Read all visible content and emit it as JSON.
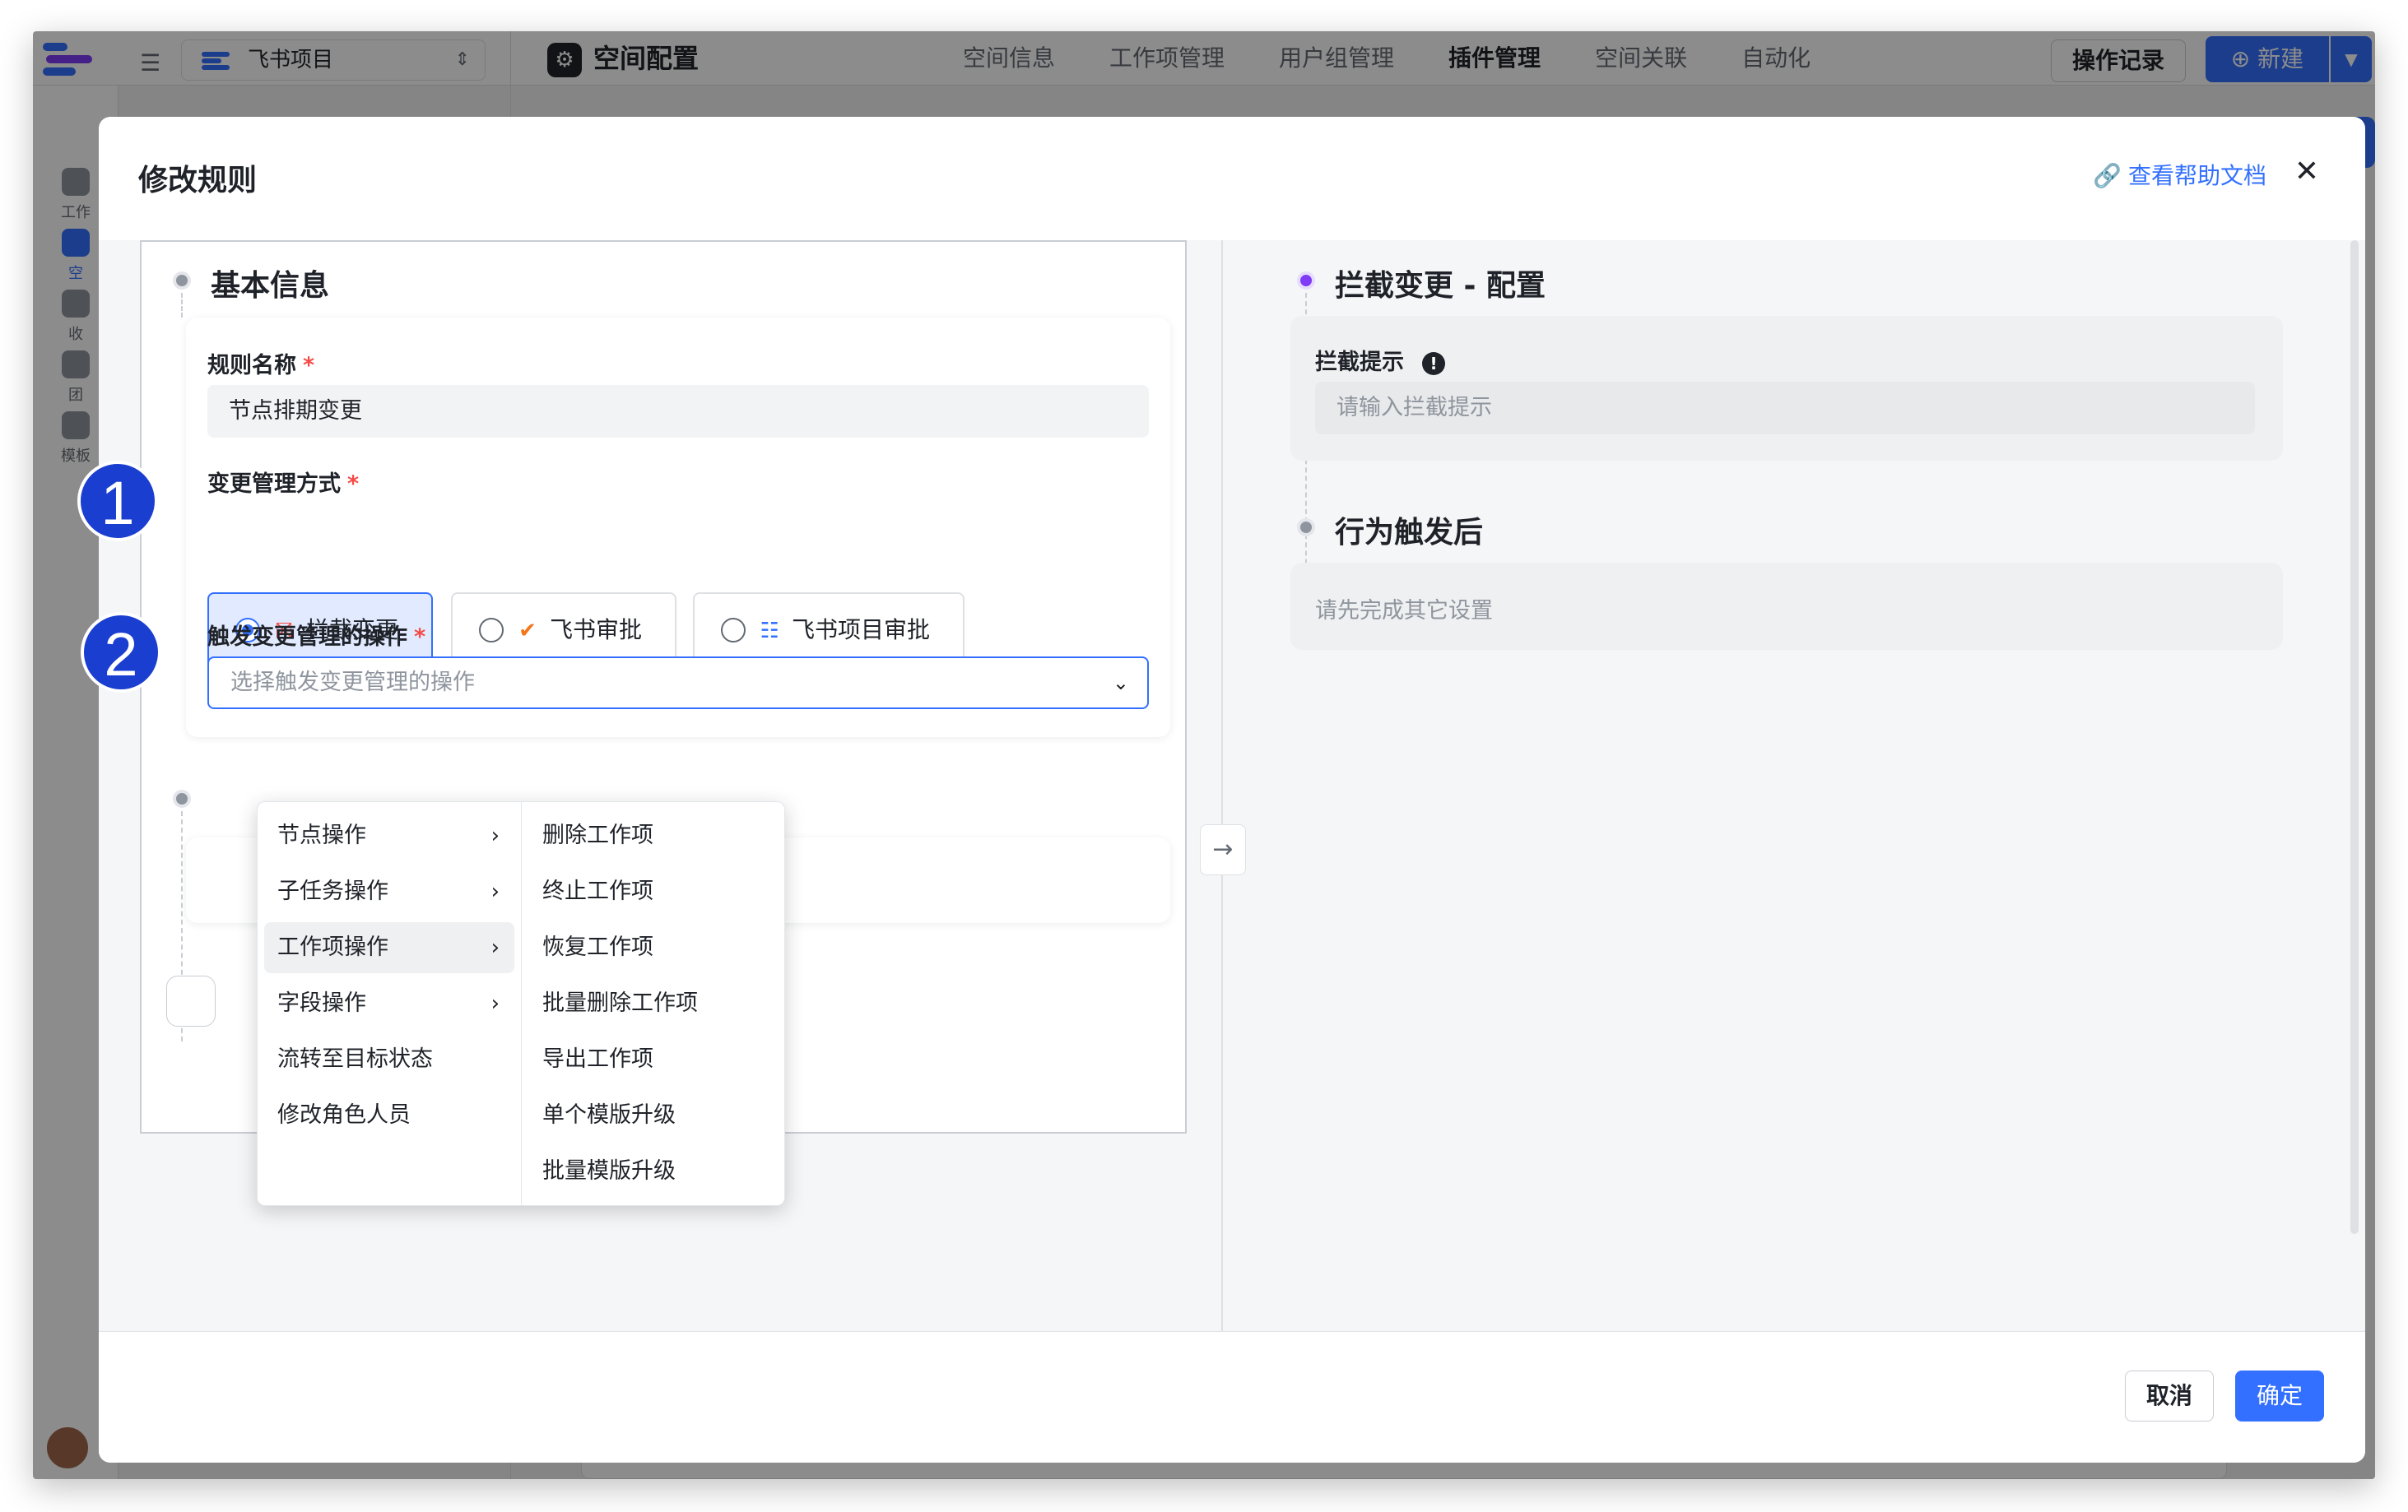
{
  "app": {
    "project_name": "飞书项目",
    "space_title": "空间配置",
    "tabs": [
      {
        "label": "空间信息",
        "active": false
      },
      {
        "label": "工作项管理",
        "active": false
      },
      {
        "label": "用户组管理",
        "active": false
      },
      {
        "label": "插件管理",
        "active": true
      },
      {
        "label": "空间关联",
        "active": false
      },
      {
        "label": "自动化",
        "active": false
      }
    ],
    "op_record_label": "操作记录",
    "new_label": "新建",
    "sidebar_items": [
      "工作",
      "空",
      "收",
      "团",
      "模板"
    ]
  },
  "modal": {
    "title": "修改规则",
    "help_link": "查看帮助文档",
    "close_symbol": "✕",
    "cancel_label": "取消",
    "ok_label": "确定"
  },
  "basic_info": {
    "section_title": "基本信息",
    "rule_name_label": "规则名称",
    "rule_name_value": "节点排期变更",
    "mode_label": "变更管理方式",
    "mode_options": [
      {
        "label": "拦截变更",
        "checked": true,
        "icon": "intercept-icon"
      },
      {
        "label": "飞书审批",
        "checked": false,
        "icon": "feishu-approval-icon"
      },
      {
        "label": "飞书项目审批",
        "checked": false,
        "icon": "feishu-project-icon"
      }
    ],
    "trigger_label": "触发变更管理的操作",
    "trigger_placeholder": "选择触发变更管理的操作",
    "required_mark": "*"
  },
  "trigger_menu": {
    "categories": [
      {
        "label": "节点操作",
        "has_children": true,
        "hover": false
      },
      {
        "label": "子任务操作",
        "has_children": true,
        "hover": false
      },
      {
        "label": "工作项操作",
        "has_children": true,
        "hover": true
      },
      {
        "label": "字段操作",
        "has_children": true,
        "hover": false
      },
      {
        "label": "流转至目标状态",
        "has_children": false,
        "hover": false
      },
      {
        "label": "修改角色人员",
        "has_children": false,
        "hover": false
      }
    ],
    "sub_items": [
      "删除工作项",
      "终止工作项",
      "恢复工作项",
      "批量删除工作项",
      "导出工作项",
      "单个模版升级",
      "批量模版升级"
    ]
  },
  "right_pane": {
    "config_title": "拦截变更 - 配置",
    "hint_label": "拦截提示",
    "hint_placeholder": "请输入拦截提示",
    "after_title": "行为触发后",
    "after_placeholder": "请先完成其它设置"
  },
  "annotations": [
    "1",
    "2"
  ],
  "colors": {
    "accent": "#3370ff",
    "required": "#f54a45",
    "badge": "#1a3ed0",
    "config_dot": "#7f3bf5"
  }
}
